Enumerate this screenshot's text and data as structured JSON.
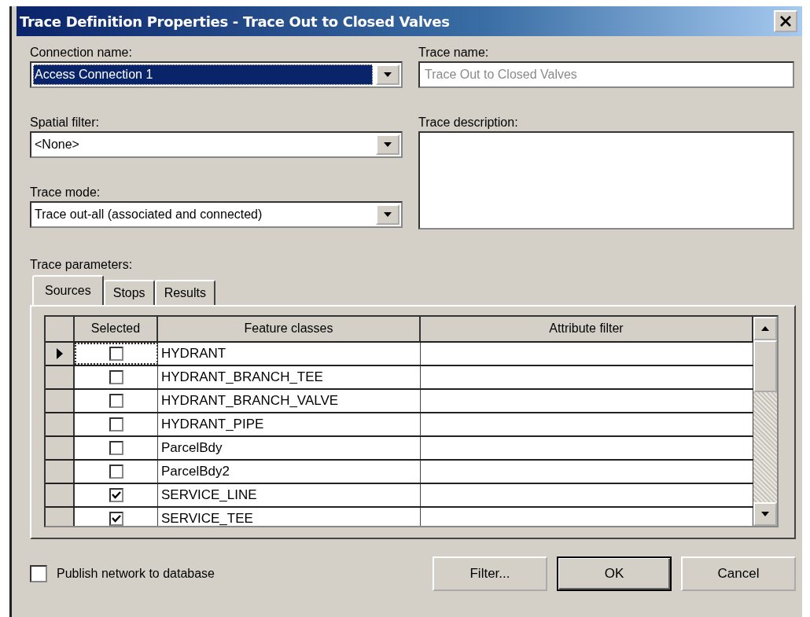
{
  "window": {
    "title": "Trace Definition Properties - Trace Out to Closed Valves"
  },
  "left_fields": [
    {
      "label": "Connection name:",
      "value": "Access Connection 1",
      "highlighted": true
    },
    {
      "label": "Spatial filter:",
      "value": "<None>",
      "highlighted": false
    },
    {
      "label": "Trace mode:",
      "value": "Trace out-all (associated and connected)",
      "highlighted": false
    }
  ],
  "trace_name": {
    "label": "Trace name:",
    "value": "Trace Out to Closed Valves",
    "disabled": true
  },
  "trace_description": {
    "label": "Trace description:"
  },
  "trace_parameters": {
    "label": "Trace parameters:",
    "tabs": [
      {
        "label": "Sources",
        "selected": true
      },
      {
        "label": "Stops",
        "selected": false
      },
      {
        "label": "Results",
        "selected": false
      }
    ],
    "table": {
      "columns": [
        "Selected",
        "Feature classes",
        "Attribute filter"
      ],
      "rows": [
        {
          "current": true,
          "checked": false,
          "feature_class": "HYDRANT"
        },
        {
          "current": false,
          "checked": false,
          "feature_class": "HYDRANT_BRANCH_TEE"
        },
        {
          "current": false,
          "checked": false,
          "feature_class": "HYDRANT_BRANCH_VALVE"
        },
        {
          "current": false,
          "checked": false,
          "feature_class": "HYDRANT_PIPE"
        },
        {
          "current": false,
          "checked": false,
          "feature_class": "ParcelBdy"
        },
        {
          "current": false,
          "checked": false,
          "feature_class": "ParcelBdy2"
        },
        {
          "current": false,
          "checked": true,
          "feature_class": "SERVICE_LINE"
        },
        {
          "current": false,
          "checked": true,
          "feature_class": "SERVICE_TEE"
        }
      ]
    }
  },
  "publish": {
    "label": "Publish network to database",
    "checked": false
  },
  "buttons": [
    {
      "label": "Filter...",
      "default": false
    },
    {
      "label": "OK",
      "default": true
    },
    {
      "label": "Cancel",
      "default": false
    }
  ]
}
